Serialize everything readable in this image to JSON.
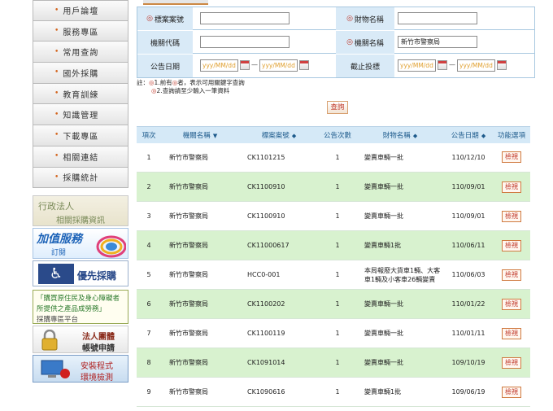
{
  "sidebar": {
    "items": [
      {
        "label": "用戶論壇"
      },
      {
        "label": "服務專區"
      },
      {
        "label": "常用查詢"
      },
      {
        "label": "國外採購"
      },
      {
        "label": "教育訓練"
      },
      {
        "label": "知識管理"
      },
      {
        "label": "下載專區"
      },
      {
        "label": "相關連結"
      },
      {
        "label": "採購統計"
      }
    ],
    "banners": {
      "admin": {
        "line1": "行政法人",
        "line2": "相關採購資訊"
      },
      "value": {
        "line1": "加值服務",
        "line2": "訂閱"
      },
      "priority": {
        "label": "優先採購",
        "icon": "wheelchair-icon"
      },
      "disabled": {
        "line1": "「購買原住民及身心障礙者",
        "line2": "所提供之產品成勞務」",
        "line3": "採購專區平台"
      },
      "legal": {
        "line1": "法人團體",
        "line2": "帳號申請"
      },
      "install": {
        "line1": "安裝程式",
        "line2": "環境檢測"
      }
    }
  },
  "search": {
    "case_no_label": "標案案號",
    "property_name_label": "財物名稱",
    "agency_code_label": "機關代碼",
    "agency_name_label": "機關名稱",
    "agency_name_value": "新竹市警察局",
    "announce_date_label": "公告日期",
    "deadline_label": "截止投標",
    "date_placeholder": "yyy/MM/dd",
    "range_sep": "—",
    "note_prefix": "註：",
    "note1": "1.前有",
    "note1b": "者，表示可用關鍵字查詢",
    "note2": "2.查詢請至少輸入一筆資料",
    "query_button": "查詢"
  },
  "results": {
    "headers": {
      "index": "項次",
      "agency": "機關名稱",
      "case_no": "標案案號",
      "count": "公告次數",
      "property": "財物名稱",
      "date": "公告日期",
      "action": "功能選項"
    },
    "rows": [
      {
        "index": "1",
        "agency": "新竹市警察局",
        "case_no": "CK1101215",
        "count": "1",
        "property": "變賣車輛一批",
        "date": "110/12/10",
        "action": "檢視"
      },
      {
        "index": "2",
        "agency": "新竹市警察局",
        "case_no": "CK1100910",
        "count": "1",
        "property": "變賣車輛一批",
        "date": "110/09/01",
        "action": "檢視"
      },
      {
        "index": "3",
        "agency": "新竹市警察局",
        "case_no": "CK1100910",
        "count": "1",
        "property": "變賣車輛一批",
        "date": "110/09/01",
        "action": "檢視"
      },
      {
        "index": "4",
        "agency": "新竹市警察局",
        "case_no": "CK11000617",
        "count": "1",
        "property": "變賣車輛1批",
        "date": "110/06/11",
        "action": "檢視"
      },
      {
        "index": "5",
        "agency": "新竹市警察局",
        "case_no": "HCC0-001",
        "count": "1",
        "property": "本局報廢大貨車1輛、大客車1輛及小客車26輛變賣",
        "date": "110/06/03",
        "action": "檢視"
      },
      {
        "index": "6",
        "agency": "新竹市警察局",
        "case_no": "CK1100202",
        "count": "1",
        "property": "變賣車輛一批",
        "date": "110/01/22",
        "action": "檢視"
      },
      {
        "index": "7",
        "agency": "新竹市警察局",
        "case_no": "CK1100119",
        "count": "1",
        "property": "變賣車輛一批",
        "date": "110/01/11",
        "action": "檢視"
      },
      {
        "index": "8",
        "agency": "新竹市警察局",
        "case_no": "CK1091014",
        "count": "1",
        "property": "變賣車輛一批",
        "date": "109/10/19",
        "action": "檢視"
      },
      {
        "index": "9",
        "agency": "新竹市警察局",
        "case_no": "CK1090616",
        "count": "1",
        "property": "變賣車輛1批",
        "date": "109/06/19",
        "action": "檢視"
      }
    ]
  },
  "colors": {
    "accent": "#c0392b",
    "header_bg": "#d5e9f7",
    "row_alt_bg": "#d8f2cf",
    "label_bg": "#d9eaf7"
  }
}
